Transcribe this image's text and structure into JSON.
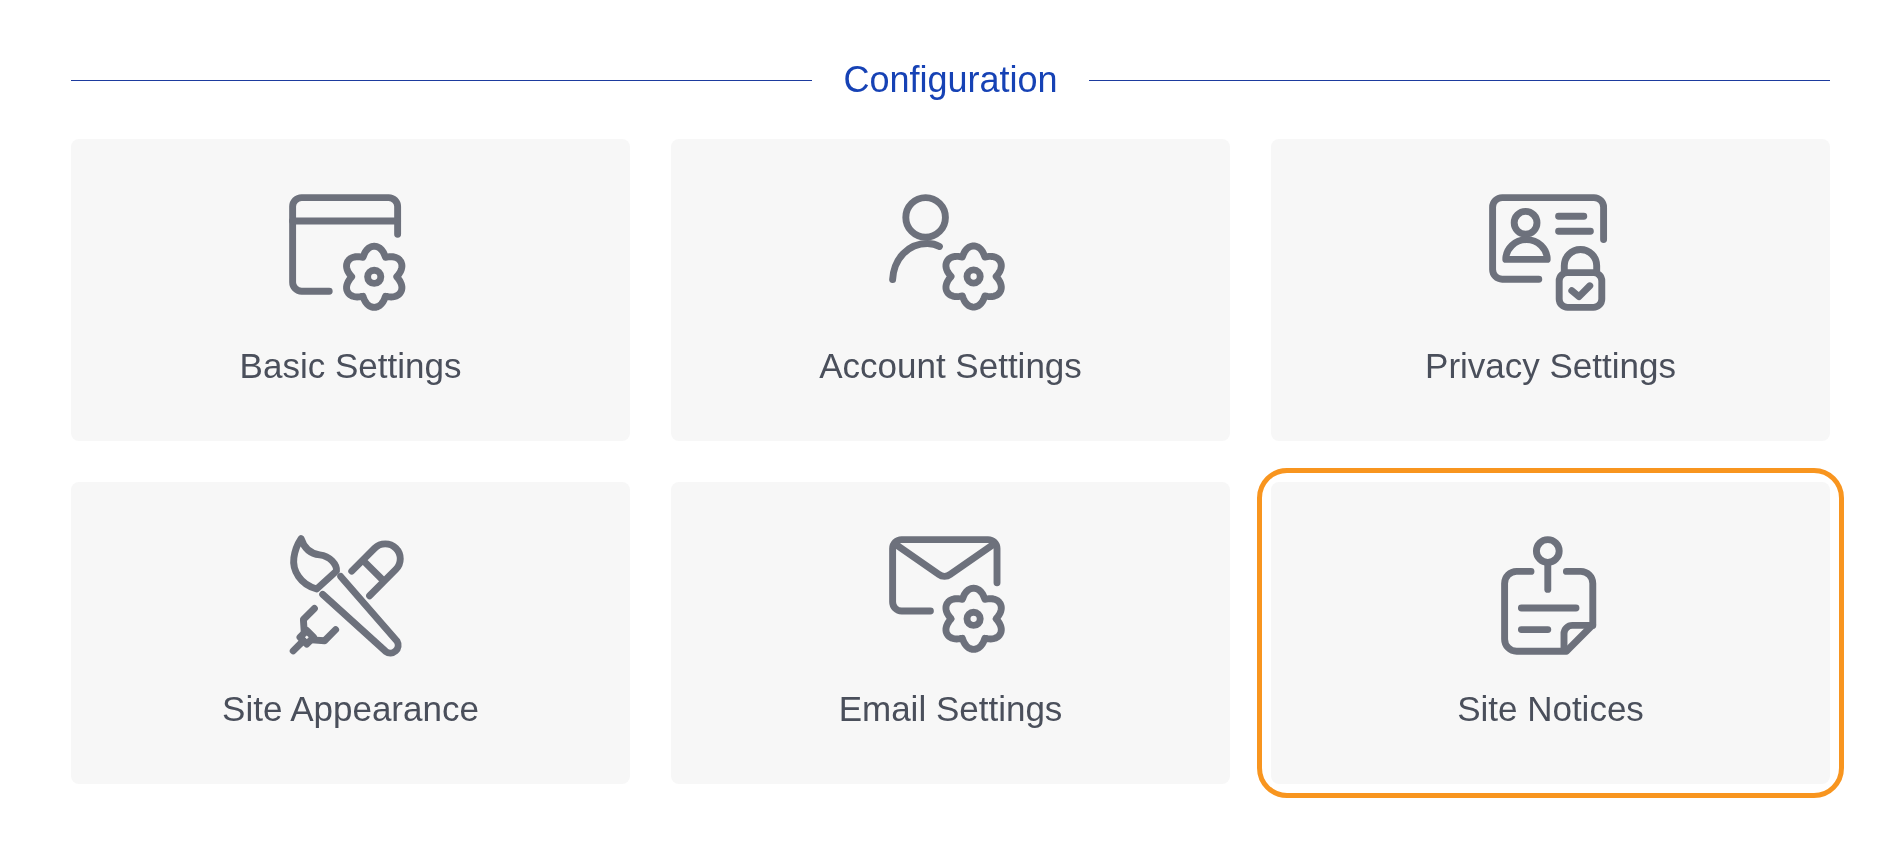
{
  "section": {
    "title": "Configuration"
  },
  "tiles": [
    {
      "kind": "basic",
      "label": "Basic Settings",
      "selected": false
    },
    {
      "kind": "account",
      "label": "Account Settings",
      "selected": false
    },
    {
      "kind": "privacy",
      "label": "Privacy Settings",
      "selected": false
    },
    {
      "kind": "appearance",
      "label": "Site Appearance",
      "selected": false
    },
    {
      "kind": "email",
      "label": "Email Settings",
      "selected": false
    },
    {
      "kind": "notices",
      "label": "Site Notices",
      "selected": true
    }
  ]
}
